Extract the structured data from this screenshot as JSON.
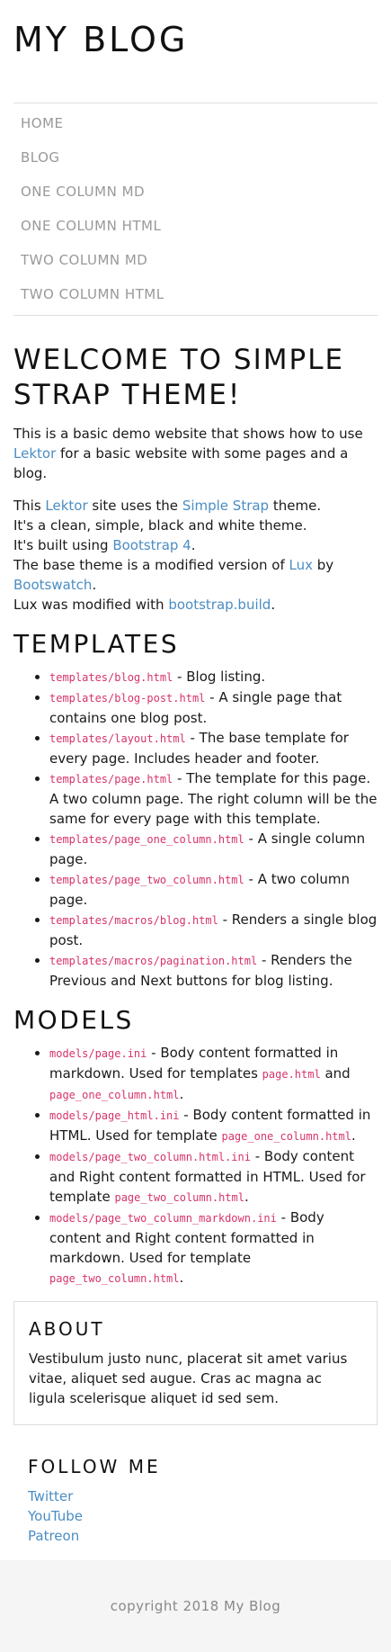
{
  "site": {
    "title": "MY BLOG"
  },
  "nav": [
    {
      "label": "HOME"
    },
    {
      "label": "BLOG"
    },
    {
      "label": "ONE COLUMN MD"
    },
    {
      "label": "ONE COLUMN HTML"
    },
    {
      "label": "TWO COLUMN MD"
    },
    {
      "label": "TWO COLUMN HTML"
    }
  ],
  "main": {
    "heading": "WELCOME TO SIMPLE STRAP THEME!",
    "intro": {
      "pre": "This is a basic demo website that shows how to use ",
      "link": "Lektor",
      "post": " for a basic website with some pages and a blog."
    },
    "about_theme": {
      "l1_a": "This ",
      "l1_link1": "Lektor",
      "l1_b": " site uses the ",
      "l1_link2": "Simple Strap",
      "l1_c": " theme.",
      "l2": "It's a clean, simple, black and white theme.",
      "l3_a": "It's built using ",
      "l3_link": "Bootstrap 4",
      "l3_b": ".",
      "l4_a": "The base theme is a modified version of ",
      "l4_link1": "Lux",
      "l4_b": " by ",
      "l4_link2": "Bootswatch",
      "l4_c": ".",
      "l5_a": "Lux was modified with ",
      "l5_link": "bootstrap.build",
      "l5_b": "."
    },
    "templates": {
      "heading": "TEMPLATES",
      "items": [
        {
          "code": "templates/blog.html",
          "desc": " - Blog listing."
        },
        {
          "code": "templates/blog-post.html",
          "desc": " - A single page that contains one blog post."
        },
        {
          "code": "templates/layout.html",
          "desc": " - The base template for every page. Includes header and footer."
        },
        {
          "code": "templates/page.html",
          "desc": " - The template for this page. A two column page. The right column will be the same for every page with this template."
        },
        {
          "code": "templates/page_one_column.html",
          "desc": " - A single column page."
        },
        {
          "code": "templates/page_two_column.html",
          "desc": " - A two column page."
        },
        {
          "code": "templates/macros/blog.html",
          "desc": " - Renders a single blog post."
        },
        {
          "code": "templates/macros/pagination.html",
          "desc": " - Renders the Previous and Next buttons for blog listing."
        }
      ]
    },
    "models": {
      "heading": "MODELS",
      "items": [
        {
          "code": "models/page.ini",
          "desc": " - Body content formatted in markdown. Used for templates ",
          "code2": "page.html",
          "mid": " and ",
          "code3": "page_one_column.html",
          "end": "."
        },
        {
          "code": "models/page_html.ini",
          "desc": " - Body content formatted in HTML. Used for template ",
          "code2": "page_one_column.html",
          "mid": "",
          "code3": "",
          "end": "."
        },
        {
          "code": "models/page_two_column.html.ini",
          "desc": " - Body content and Right content formatted in HTML. Used for template ",
          "code2": "page_two_column.html",
          "mid": "",
          "code3": "",
          "end": "."
        },
        {
          "code": "models/page_two_column_markdown.ini",
          "desc": " - Body content and Right content formatted in markdown. Used for template ",
          "code2": "page_two_column.html",
          "mid": "",
          "code3": "",
          "end": "."
        }
      ]
    }
  },
  "sidebar": {
    "about": {
      "heading": "ABOUT",
      "text": "Vestibulum justo nunc, placerat sit amet varius vitae, aliquet sed augue. Cras ac magna ac ligula scelerisque aliquet id sed sem."
    },
    "follow": {
      "heading": "FOLLOW ME",
      "links": [
        {
          "label": "Twitter"
        },
        {
          "label": "YouTube"
        },
        {
          "label": "Patreon"
        }
      ]
    }
  },
  "footer": {
    "text": "copyright 2018 My Blog"
  },
  "colors": {
    "link": "#4a8dc3",
    "code": "#d6336c",
    "nav": "#999999",
    "footer_bg": "#f5f5f6"
  }
}
